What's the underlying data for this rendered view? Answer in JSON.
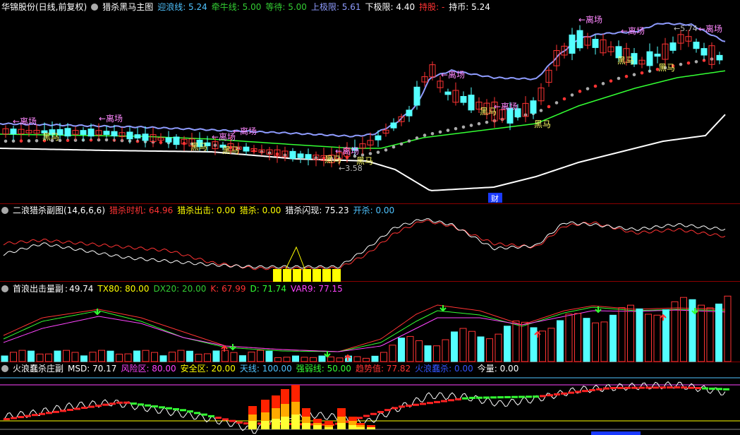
{
  "main": {
    "stock": "华锦股份(日线,前复权)",
    "indicator": "猎杀黑马主图",
    "fields": [
      {
        "label": "迎浪线:",
        "value": "5.24",
        "color": "#4fc3ff"
      },
      {
        "label": "牵牛线:",
        "value": "5.00",
        "color": "#33cc33"
      },
      {
        "label": "等待:",
        "value": "5.00",
        "color": "#33cc33"
      },
      {
        "label": "上极限:",
        "value": "5.61",
        "color": "#8f9cff"
      },
      {
        "label": "下极限:",
        "value": "4.40",
        "color": "#ffffff"
      },
      {
        "label": "持股:",
        "value": "-",
        "color": "#ff3333"
      },
      {
        "label": "持币:",
        "value": "5.24",
        "color": "#ffffff"
      }
    ],
    "annotations": {
      "leave": "←离场",
      "horse": "黑马",
      "low": "←3.58",
      "high": "←5.74",
      "cai": "财"
    }
  },
  "sub1": {
    "name": "二浪猎杀副图",
    "params": "(14,6,6,6)",
    "fields": [
      {
        "label": "猎杀时机:",
        "value": "64.96",
        "color": "#ff3333"
      },
      {
        "label": "猎杀出击:",
        "value": "0.00",
        "color": "#ffff00"
      },
      {
        "label": "猎杀:",
        "value": "0.00",
        "color": "#ffff00"
      },
      {
        "label": "猎杀闪现:",
        "value": "75.23",
        "color": "#ffffff"
      },
      {
        "label": "开杀:",
        "value": "0.00",
        "color": "#4fc3ff"
      }
    ]
  },
  "sub2": {
    "name": "首浪出击量副",
    "params": ":",
    "fields": [
      {
        "label": "",
        "value": "49.74",
        "color": "#ffffff"
      },
      {
        "label": "TX80:",
        "value": "80.00",
        "color": "#ffff00"
      },
      {
        "label": "DX20:",
        "value": "20.00",
        "color": "#33cc33"
      },
      {
        "label": "K:",
        "value": "67.99",
        "color": "#ff3333"
      },
      {
        "label": "D:",
        "value": "71.74",
        "color": "#33ff33"
      },
      {
        "label": "VAR9:",
        "value": "77.15",
        "color": "#ff44ff"
      }
    ]
  },
  "sub3": {
    "name": "火浪蠢杀庄副",
    "params": "",
    "fields": [
      {
        "label": "MSD:",
        "value": "70.17",
        "color": "#ffffff"
      },
      {
        "label": "风险区:",
        "value": "80.00",
        "color": "#ff44ff"
      },
      {
        "label": "安全区:",
        "value": "20.00",
        "color": "#ffff00"
      },
      {
        "label": "天线:",
        "value": "100.00",
        "color": "#4fc3ff"
      },
      {
        "label": "强弱线:",
        "value": "50.00",
        "color": "#33ff33"
      },
      {
        "label": "趋势值:",
        "value": "77.82",
        "color": "#ff3333"
      },
      {
        "label": "火浪蠢杀:",
        "value": "0.00",
        "color": "#3355ff"
      },
      {
        "label": "今量:",
        "value": "0.00",
        "color": "#ffffff"
      }
    ]
  },
  "colors": {
    "up": "#ff3333",
    "down": "#54ffff",
    "sep": "#8b0000"
  }
}
